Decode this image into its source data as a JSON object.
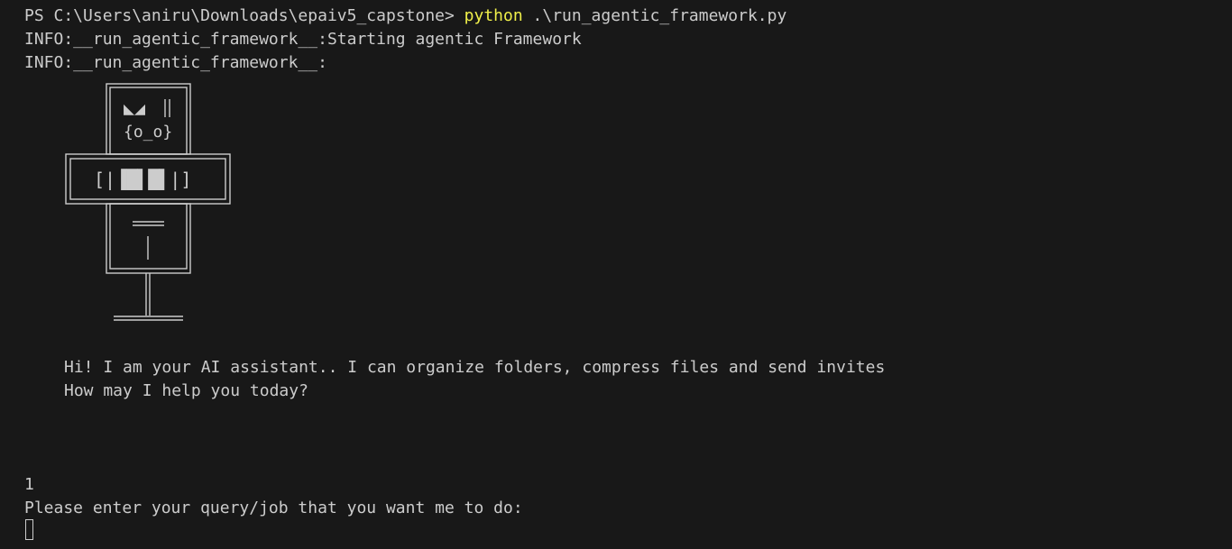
{
  "terminal": {
    "prompt": "PS C:\\Users\\aniru\\Downloads\\epaiv5_capstone> ",
    "command": "python",
    "command_args": " .\\run_agentic_framework.py",
    "log_line_1": "INFO:__run_agentic_framework__:Starting agentic Framework",
    "log_line_2": "INFO:__run_agentic_framework__:",
    "robot_eyes": "◣◢",
    "robot_face": "{o_o}",
    "robot_chest": "[|▐█▌█▌|]",
    "greeting_line_1": "Hi! I am your AI assistant.. I can organize folders, compress files and send invites",
    "greeting_line_2": "How may I help you today?",
    "counter": "1",
    "query_prompt": "Please enter your query/job that you want me to do:"
  },
  "colors": {
    "background": "#181818",
    "text": "#cccccc",
    "command_highlight": "#f0f04a"
  }
}
